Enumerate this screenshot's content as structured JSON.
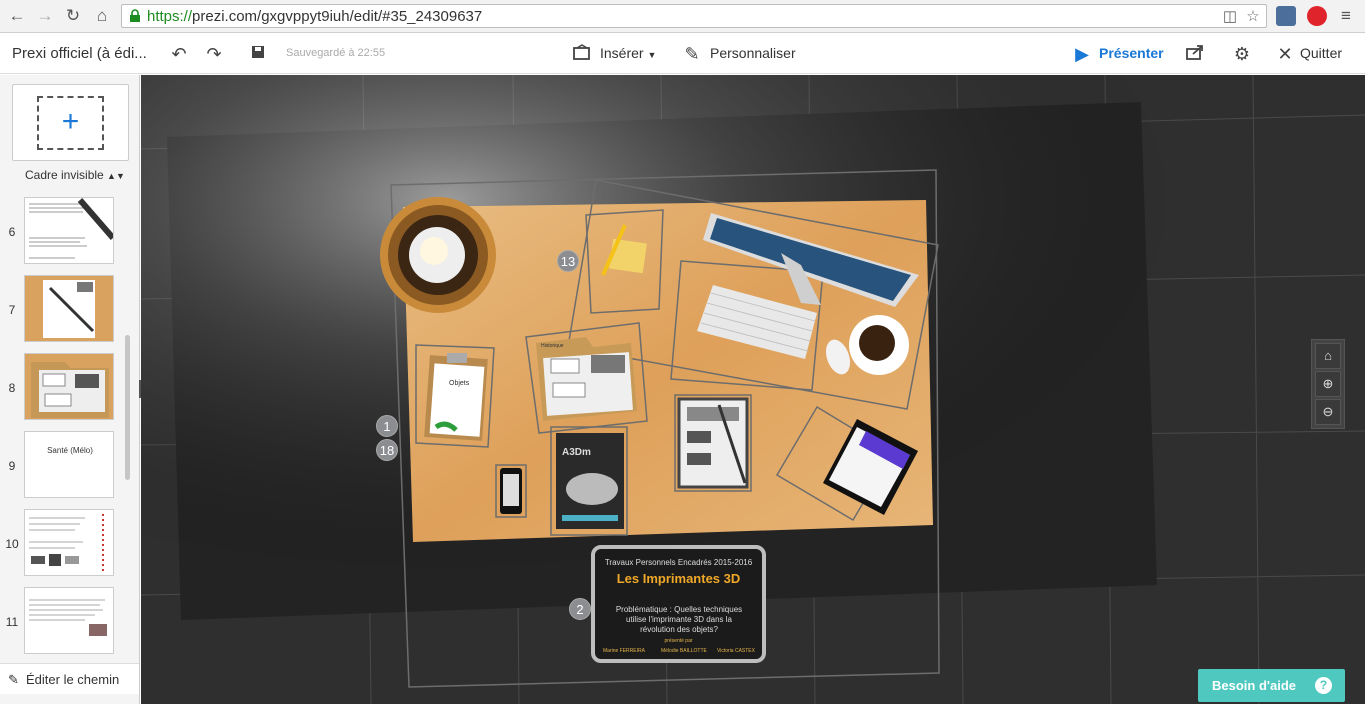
{
  "browser": {
    "url_scheme": "https://",
    "url_rest": "prezi.com/gxgvppyt9iuh/edit/#35_24309637"
  },
  "toolbar": {
    "title": "Prexi officiel (à édi...",
    "saved_status": "Sauvegardé à 22:55",
    "insert_label": "Insérer",
    "customize_label": "Personnaliser",
    "present_label": "Présenter",
    "quit_label": "Quitter"
  },
  "sidebar": {
    "frame_type": "Cadre invisible",
    "thumbnails": [
      {
        "num": "6"
      },
      {
        "num": "7"
      },
      {
        "num": "8"
      },
      {
        "num": "9",
        "caption": "Santé (Mélo)"
      },
      {
        "num": "10"
      },
      {
        "num": "11"
      }
    ],
    "edit_path_label": "Éditer le chemin"
  },
  "canvas": {
    "path_numbers": [
      "13",
      "1",
      "18",
      "2"
    ],
    "desk_labels": {
      "clipboard": "Objets",
      "folder": "Historique",
      "magazine_title": "A3Dm"
    },
    "title_card": {
      "line1": "Travaux Personnels Encadrés 2015-2016",
      "title": "Les Imprimantes 3D",
      "problem": "Problématique : Quelles techniques utilise l'imprimante 3D dans la révolution des objets?",
      "presented_by": "présenté par",
      "authors": [
        "Marine FERREIRA",
        "Mélodie BAILLOTTE",
        "Victoria CASTEX"
      ]
    },
    "help_label": "Besoin d'aide"
  },
  "colors": {
    "accent_blue": "#1a78d6",
    "help_teal": "#4fc9c0",
    "canvas_bg": "#2f2f2f",
    "desk_wood": "#e0a860"
  }
}
